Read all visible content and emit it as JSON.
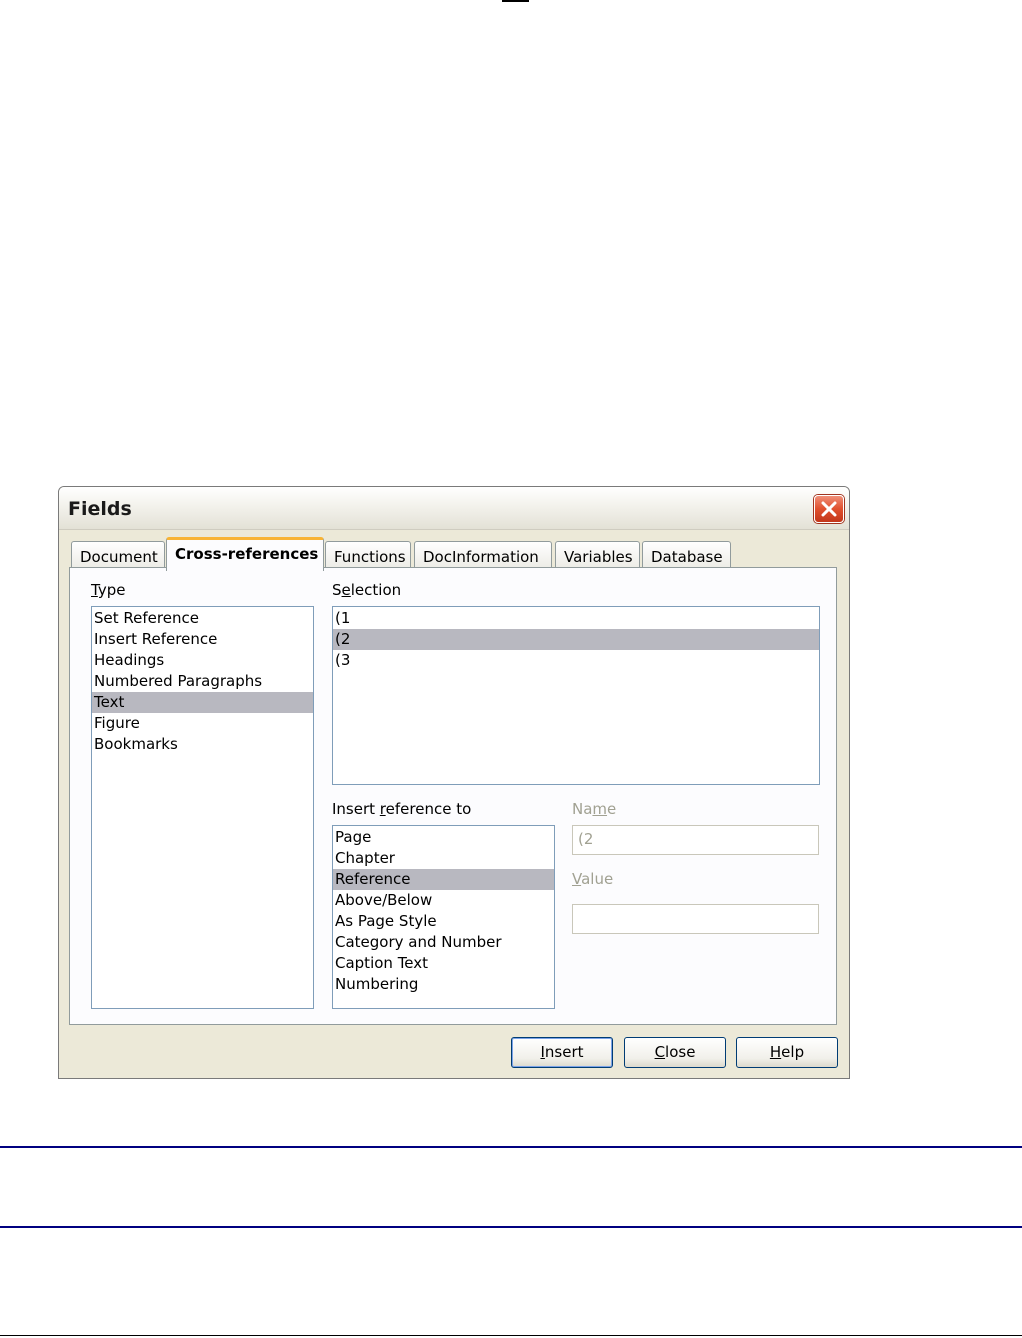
{
  "dialog": {
    "title": "Fields",
    "close_icon": "close-icon"
  },
  "tabs": [
    {
      "label": "Document"
    },
    {
      "label": "Cross-references"
    },
    {
      "label": "Functions"
    },
    {
      "label": "DocInformation"
    },
    {
      "label": "Variables"
    },
    {
      "label": "Database"
    }
  ],
  "active_tab": "Cross-references",
  "type": {
    "label_first": "T",
    "label_rest": "ype",
    "items": [
      "Set Reference",
      "Insert Reference",
      "Headings",
      "Numbered Paragraphs",
      "Text",
      "Figure",
      "Bookmarks"
    ],
    "selected": "Text"
  },
  "selection": {
    "label_a": "S",
    "label_b": "e",
    "label_c": "lection",
    "items": [
      "(1",
      "(2",
      "(3"
    ],
    "selected": "(2"
  },
  "insert_reference_to": {
    "label_a": "Insert ",
    "label_b": "r",
    "label_c": "eference to",
    "items": [
      "Page",
      "Chapter",
      "Reference",
      "Above/Below",
      "As Page Style",
      "Category and Number",
      "Caption Text",
      "Numbering"
    ],
    "selected": "Reference"
  },
  "name": {
    "label_a": "Na",
    "label_b": "m",
    "label_c": "e",
    "value": "(2"
  },
  "value": {
    "label_a": "V",
    "label_b": "alue",
    "value": ""
  },
  "buttons": {
    "insert_a": "I",
    "insert_b": "nsert",
    "close_a": "C",
    "close_b": "lose",
    "help_a": "H",
    "help_b": "elp"
  },
  "colors": {
    "selection_bg": "#b8b8c0",
    "rule": "#000080",
    "active_tab_accent": "#f8b334"
  }
}
